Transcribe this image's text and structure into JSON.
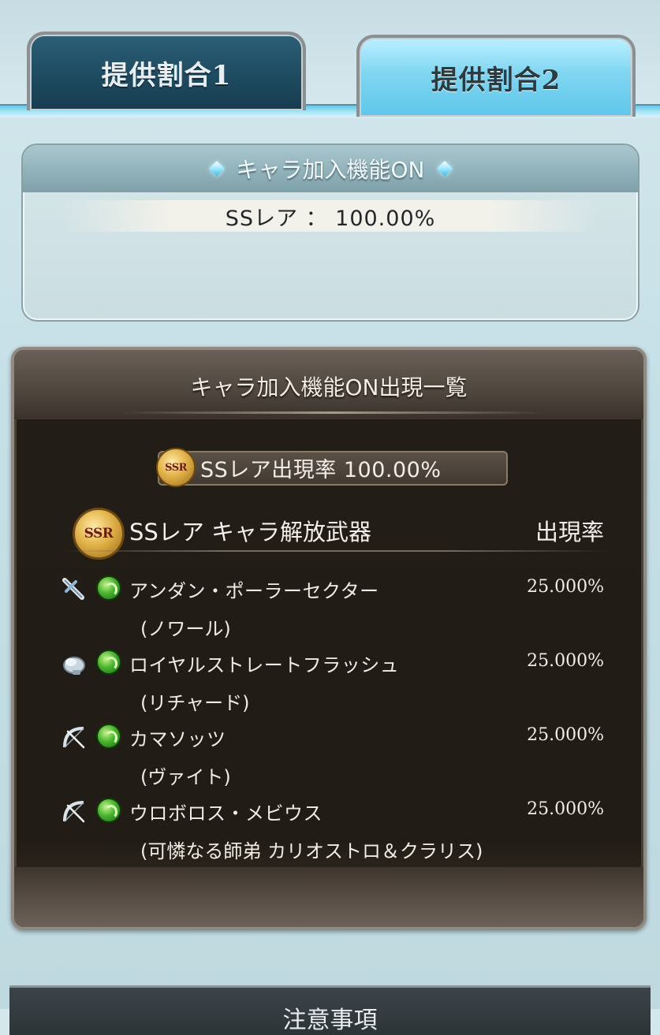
{
  "tabs": [
    {
      "label": "提供割合1",
      "active": false
    },
    {
      "label": "提供割合2",
      "active": true
    }
  ],
  "feature": {
    "title": "キャラ加入機能ON",
    "rate_text": "SSレア ： 100.00%"
  },
  "list": {
    "title": "キャラ加入機能ON出現一覧",
    "rarity_rate": "SSレア出現率 100.00%",
    "badge": "SSR",
    "column_name": "SSレア キャラ解放武器",
    "column_rate": "出現率",
    "items": [
      {
        "weapon_icon": "dagger-icon",
        "element_icon": "wind-element-icon",
        "name": "アンダン・ポーラーセクター",
        "character": "(ノワール)",
        "rate": "25.000%"
      },
      {
        "weapon_icon": "fist-icon",
        "element_icon": "wind-element-icon",
        "name": "ロイヤルストレートフラッシュ",
        "character": "(リチャード)",
        "rate": "25.000%"
      },
      {
        "weapon_icon": "bow-icon",
        "element_icon": "wind-element-icon",
        "name": "カマソッツ",
        "character": "(ヴァイト)",
        "rate": "25.000%"
      },
      {
        "weapon_icon": "bow-icon",
        "element_icon": "wind-element-icon",
        "name": "ウロボロス・メビウス",
        "character": "(可憐なる師弟 カリオストロ＆クラリス)",
        "rate": "25.000%"
      }
    ]
  },
  "notes": {
    "title": "注意事項"
  },
  "colors": {
    "active_tab": "#7fd6f2",
    "inactive_tab": "#1e4b61",
    "list_bg": "#221c16",
    "element_wind": "#47b52c"
  }
}
